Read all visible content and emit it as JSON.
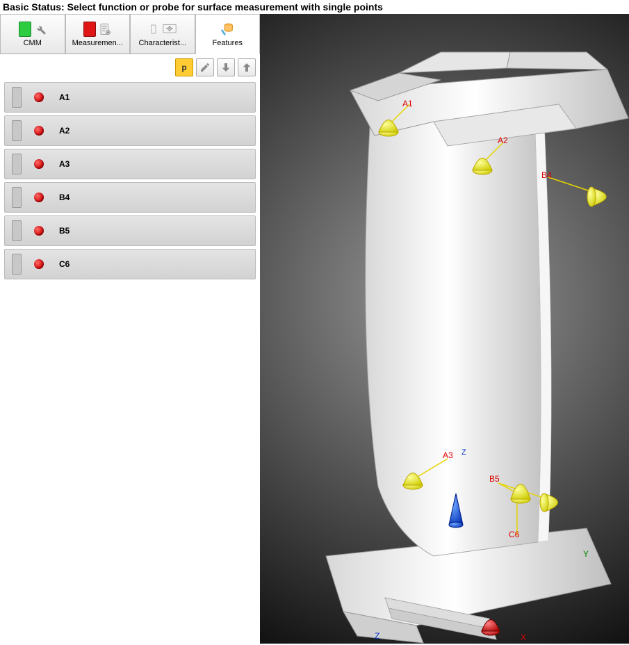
{
  "status_bar": {
    "text": "Basic Status: Select function or probe for surface measurement with single points"
  },
  "tabs": [
    {
      "label": "CMM"
    },
    {
      "label": "Measuremen..."
    },
    {
      "label": "Characterist..."
    },
    {
      "label": "Features"
    }
  ],
  "active_tab_index": 3,
  "toolbar": {
    "p_label": "p"
  },
  "features": [
    {
      "label": "A1"
    },
    {
      "label": "A2"
    },
    {
      "label": "A3"
    },
    {
      "label": "B4"
    },
    {
      "label": "B5"
    },
    {
      "label": "C6"
    }
  ],
  "viewport": {
    "point_labels": [
      "A1",
      "A2",
      "A3",
      "B4",
      "B5",
      "C6"
    ],
    "axes": {
      "x": "X",
      "y": "Y",
      "z": "Z"
    }
  }
}
